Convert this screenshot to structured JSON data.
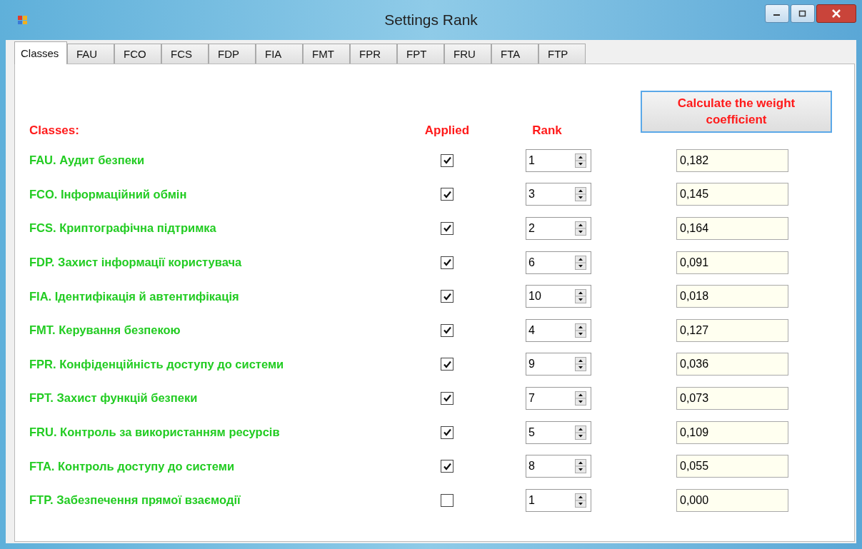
{
  "window": {
    "title": "Settings Rank"
  },
  "tabs": [
    {
      "label": "Classes",
      "selected": true
    },
    {
      "label": "FAU",
      "selected": false
    },
    {
      "label": "FCO",
      "selected": false
    },
    {
      "label": "FCS",
      "selected": false
    },
    {
      "label": "FDP",
      "selected": false
    },
    {
      "label": "FIA",
      "selected": false
    },
    {
      "label": "FMT",
      "selected": false
    },
    {
      "label": "FPR",
      "selected": false
    },
    {
      "label": "FPT",
      "selected": false
    },
    {
      "label": "FRU",
      "selected": false
    },
    {
      "label": "FTA",
      "selected": false
    },
    {
      "label": "FTP",
      "selected": false
    }
  ],
  "headers": {
    "classes": "Classes:",
    "applied": "Applied",
    "rank": "Rank"
  },
  "calculate_button": "Calculate the weight coefficient",
  "rows": [
    {
      "name": "FAU. Аудит безпеки",
      "applied": true,
      "rank": "1",
      "weight": "0,182"
    },
    {
      "name": "FCO. Інформаційний обмін",
      "applied": true,
      "rank": "3",
      "weight": "0,145"
    },
    {
      "name": "FCS. Криптографічна підтримка",
      "applied": true,
      "rank": "2",
      "weight": "0,164"
    },
    {
      "name": "FDP. Захист інформації користувача",
      "applied": true,
      "rank": "6",
      "weight": "0,091"
    },
    {
      "name": "FIA. Ідентифікація й автентифікація",
      "applied": true,
      "rank": "10",
      "weight": "0,018"
    },
    {
      "name": "FMT. Керування безпекою",
      "applied": true,
      "rank": "4",
      "weight": "0,127"
    },
    {
      "name": "FPR. Конфіденційність доступу до системи",
      "applied": true,
      "rank": "9",
      "weight": "0,036"
    },
    {
      "name": "FPT. Захист функцій безпеки",
      "applied": true,
      "rank": "7",
      "weight": "0,073"
    },
    {
      "name": "FRU. Контроль за використанням ресурсів",
      "applied": true,
      "rank": "5",
      "weight": "0,109"
    },
    {
      "name": "FTA. Контроль доступу до системи",
      "applied": true,
      "rank": "8",
      "weight": "0,055"
    },
    {
      "name": "FTP. Забезпечення прямої взаємодії",
      "applied": false,
      "rank": "1",
      "weight": "0,000"
    }
  ]
}
